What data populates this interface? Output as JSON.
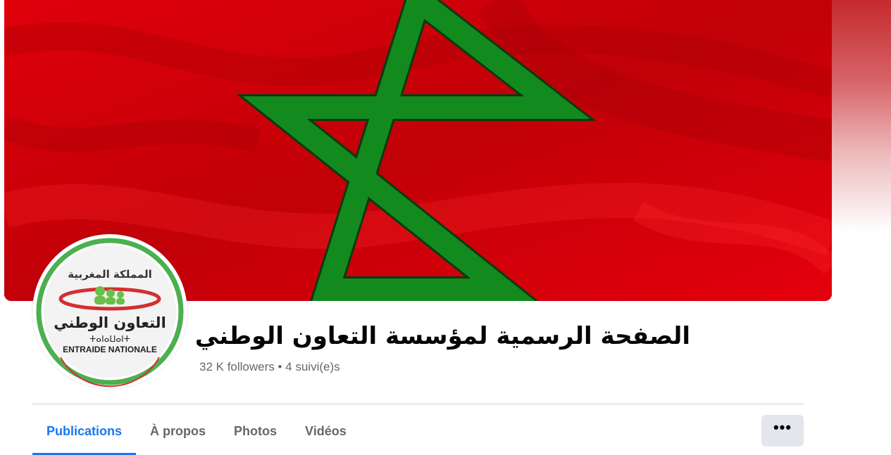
{
  "page": {
    "title": "الصفحة الرسمية لمؤسسة التعاون الوطني",
    "followers_text": "32 K followers • 4 suivi(e)s"
  },
  "avatar_logo": {
    "top_text": "المملكة المغربية",
    "arabic_name": "التعاون الوطني",
    "tifinagh_name": "ⵜⴰⵏⴰⵡⴰⵏⵜ",
    "french_name": "ENTRAIDE NATIONALE"
  },
  "tabs": [
    {
      "label": "Publications",
      "active": true
    },
    {
      "label": "À propos",
      "active": false
    },
    {
      "label": "Photos",
      "active": false
    },
    {
      "label": "Vidéos",
      "active": false
    }
  ],
  "more_button": {
    "label": "•••",
    "icon": "more-horizontal-icon"
  },
  "colors": {
    "flag_red": "#d9000a",
    "star_green": "#138a1e",
    "accent_blue": "#1877f2",
    "logo_green": "#4caf50",
    "logo_red": "#d32f2f"
  }
}
